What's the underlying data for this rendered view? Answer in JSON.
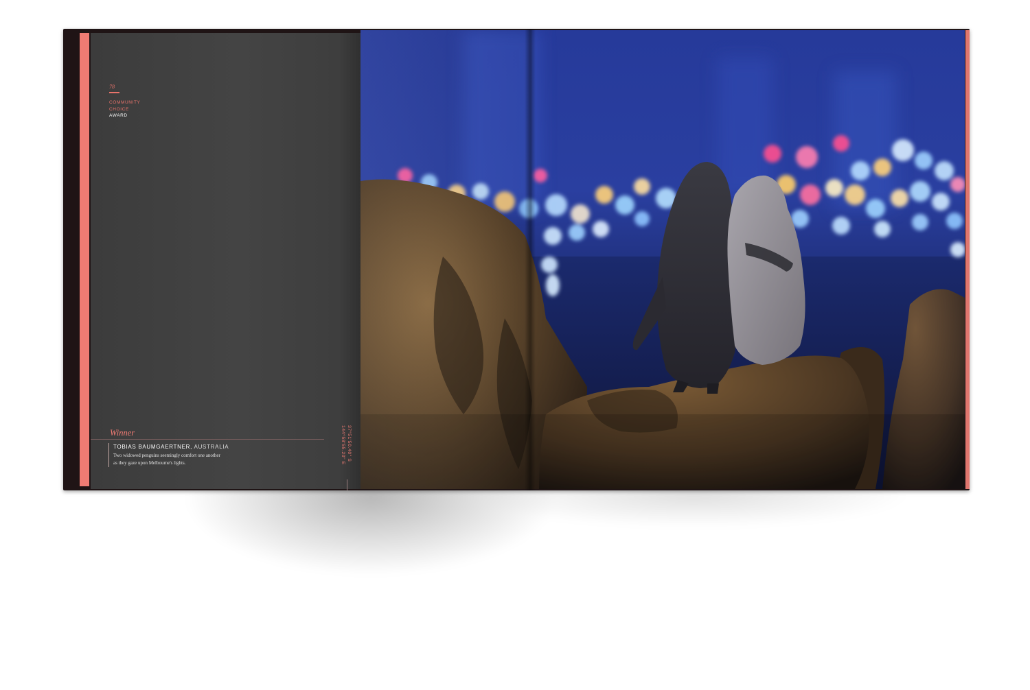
{
  "left_page": {
    "page_number": "78",
    "award_line1": "COMMUNITY",
    "award_line2": "CHOICE",
    "award_line3": "AWARD",
    "winner_heading": "Winner",
    "photographer_name": "TOBIAS BAUMGAERTNER,",
    "photographer_country": " AUSTRALIA",
    "caption_line1": "Two widowed penguins seemingly comfort one another",
    "caption_line2": "as they gaze upon Melbourne's lights.",
    "coordinates_lat": "37°51'50.40\" S",
    "coordinates_lon": "144°58'55.20\" E"
  },
  "colors": {
    "accent": "#ef7b73",
    "page_gray": "#444444",
    "cover": "#1f1415"
  },
  "photo": {
    "subject": "penguins-on-rock-at-night"
  }
}
